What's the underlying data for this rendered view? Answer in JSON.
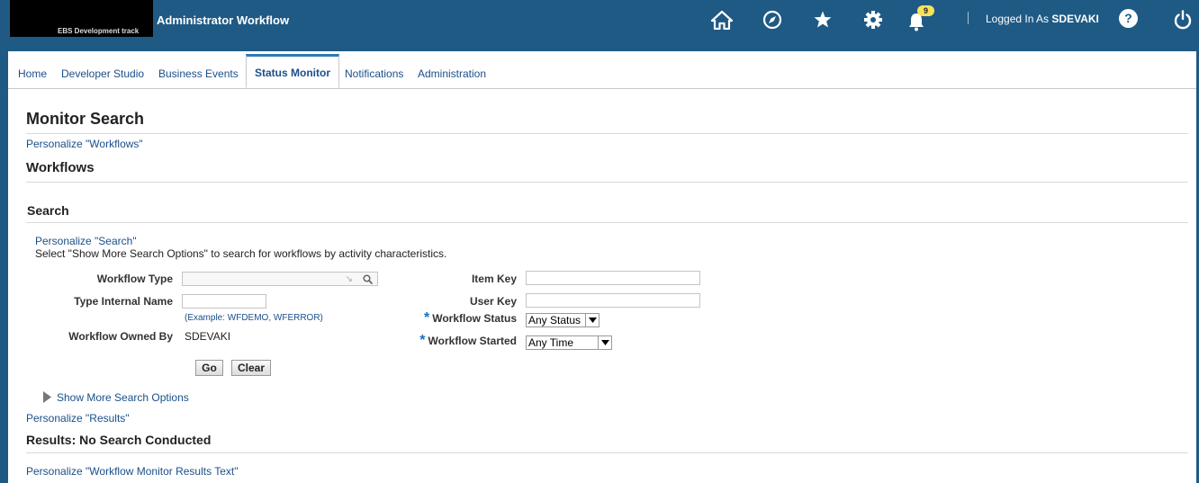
{
  "header": {
    "logo_text": "EBS Development track",
    "app_title": "Administrator Workflow",
    "notification_count": "9",
    "logged_in_label": "Logged In As",
    "user_name": "SDEVAKI",
    "icons": [
      "home-icon",
      "compass-icon",
      "star-icon",
      "gear-icon",
      "bell-icon",
      "help-icon",
      "power-icon"
    ]
  },
  "tabs": [
    {
      "label": "Home",
      "active": false
    },
    {
      "label": "Developer Studio",
      "active": false
    },
    {
      "label": "Business Events",
      "active": false
    },
    {
      "label": "Status Monitor",
      "active": true
    },
    {
      "label": "Notifications",
      "active": false
    },
    {
      "label": "Administration",
      "active": false
    }
  ],
  "page": {
    "title": "Monitor Search",
    "personalize_workflows": "Personalize \"Workflows\"",
    "workflows_heading": "Workflows",
    "search_heading": "Search",
    "personalize_search": "Personalize \"Search\"",
    "instructions": "Select \"Show More Search Options\" to search for workflows by activity characteristics.",
    "fields": {
      "workflow_type_label": "Workflow Type",
      "workflow_type_value": "",
      "type_internal_name_label": "Type Internal Name",
      "type_internal_name_value": "",
      "type_internal_name_hint": "(Example: WFDEMO, WFERROR)",
      "owned_by_label": "Workflow Owned By",
      "owned_by_value": "SDEVAKI",
      "item_key_label": "Item Key",
      "item_key_value": "",
      "user_key_label": "User Key",
      "user_key_value": "",
      "required_mark": "*",
      "status_label": "Workflow Status",
      "status_value": "Any Status",
      "started_label": "Workflow Started",
      "started_value": "Any Time"
    },
    "go_label": "Go",
    "clear_label": "Clear",
    "show_more": "Show More Search Options",
    "personalize_results": "Personalize \"Results\"",
    "results_heading": "Results: No Search Conducted",
    "personalize_results_text": "Personalize \"Workflow Monitor Results Text\""
  }
}
